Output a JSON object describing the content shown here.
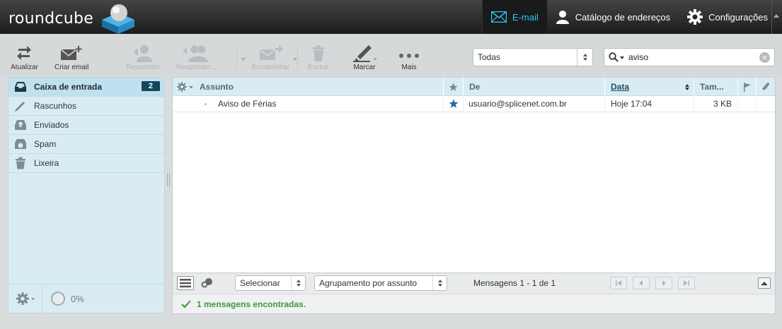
{
  "app": {
    "logo_text": "roundcube"
  },
  "topnav": {
    "items": [
      {
        "label": "E-mail",
        "icon": "envelope-icon",
        "active": true
      },
      {
        "label": "Catálogo de endereços",
        "icon": "person-icon",
        "active": false
      },
      {
        "label": "Configurações",
        "icon": "gear-icon",
        "active": false
      }
    ]
  },
  "toolbar": {
    "refresh": "Atualizar",
    "compose": "Criar email",
    "reply": "Responder",
    "reply_all": "Responder...",
    "forward": "Encaminhar",
    "delete": "Excluir",
    "mark": "Marcar",
    "more": "Mais"
  },
  "filter": {
    "selected": "Todas"
  },
  "search": {
    "value": "aviso"
  },
  "folders": [
    {
      "label": "Caixa de entrada",
      "icon": "inbox-icon",
      "count": "2",
      "selected": true
    },
    {
      "label": "Rascunhos",
      "icon": "pencil-icon",
      "selected": false
    },
    {
      "label": "Enviados",
      "icon": "sent-icon",
      "selected": false
    },
    {
      "label": "Spam",
      "icon": "spam-icon",
      "selected": false
    },
    {
      "label": "Lixeira",
      "icon": "trash-icon",
      "selected": false
    }
  ],
  "quota": {
    "label": "0%",
    "value": 0
  },
  "list": {
    "columns": {
      "subject": "Assunto",
      "from": "De",
      "date": "Data",
      "size": "Tam..."
    },
    "messages": [
      {
        "subject": "Aviso de Férias",
        "from": "usuario@splicenet.com.br",
        "date": "Hoje 17:04",
        "size": "3 KB",
        "flagged": true
      }
    ]
  },
  "footer": {
    "select": "Selecionar",
    "threads": "Agrupamento por assunto",
    "count": "Mensagens 1 - 1 de 1"
  },
  "status": {
    "message": "1 mensagens encontradas."
  },
  "colors": {
    "accent": "#2ec5f3",
    "folder_bg": "#d9ecf4",
    "badge": "#13465d",
    "status_ok": "#3a9b3a"
  }
}
